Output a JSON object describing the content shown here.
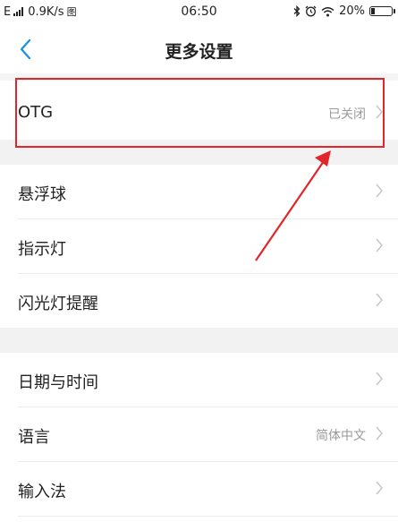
{
  "status_bar": {
    "network": "E",
    "speed": "0.9K/s",
    "notification_glyph": "图",
    "time": "06:50",
    "battery_percent": "20%",
    "battery_level": 0.2
  },
  "header": {
    "title": "更多设置",
    "back_icon": "chevron-left-icon"
  },
  "settings_groups": [
    [
      {
        "label": "OTG",
        "value": "已关闭"
      }
    ],
    [
      {
        "label": "悬浮球",
        "value": ""
      },
      {
        "label": "指示灯",
        "value": ""
      },
      {
        "label": "闪光灯提醒",
        "value": ""
      }
    ],
    [
      {
        "label": "日期与时间",
        "value": ""
      },
      {
        "label": "语言",
        "value": "简体中文"
      },
      {
        "label": "输入法",
        "value": ""
      }
    ]
  ],
  "annotation": {
    "highlight_color": "#e0262a"
  },
  "colors": {
    "accent": "#1a8fe0",
    "gap_background": "#f2f2f2",
    "value_text": "#9a9a9a"
  }
}
